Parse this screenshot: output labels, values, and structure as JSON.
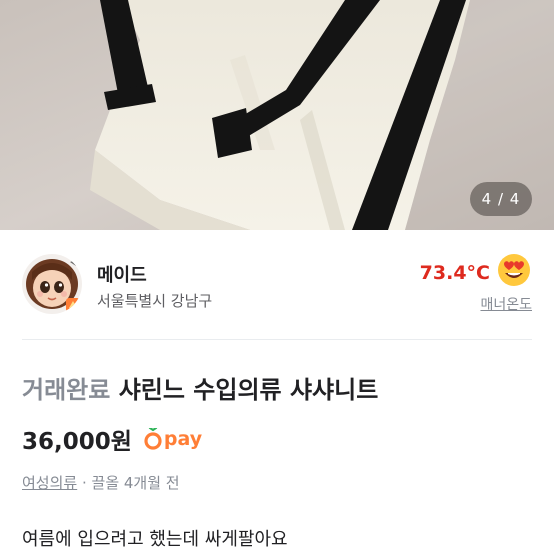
{
  "photo": {
    "counter": "4 / 4"
  },
  "seller": {
    "name": "메이드",
    "region": "서울특별시 강남구",
    "temperature": "73.4°C",
    "temperature_label": "매너온도",
    "temperature_emoji": "heart-eyes-emoji"
  },
  "article": {
    "status": "거래완료",
    "title": "샤린느 수입의류 샤샤니트",
    "price": "36,000원",
    "pay_label": "pay",
    "category": "여성의류",
    "meta_sep": " · ",
    "time": "끌올 4개월 전",
    "description": "여름에 입으려고 했는데 싸게팔아요"
  },
  "colors": {
    "accent_orange": "#ff7e36",
    "temperature_red": "#de2a1e",
    "muted_gray": "#868b94"
  }
}
